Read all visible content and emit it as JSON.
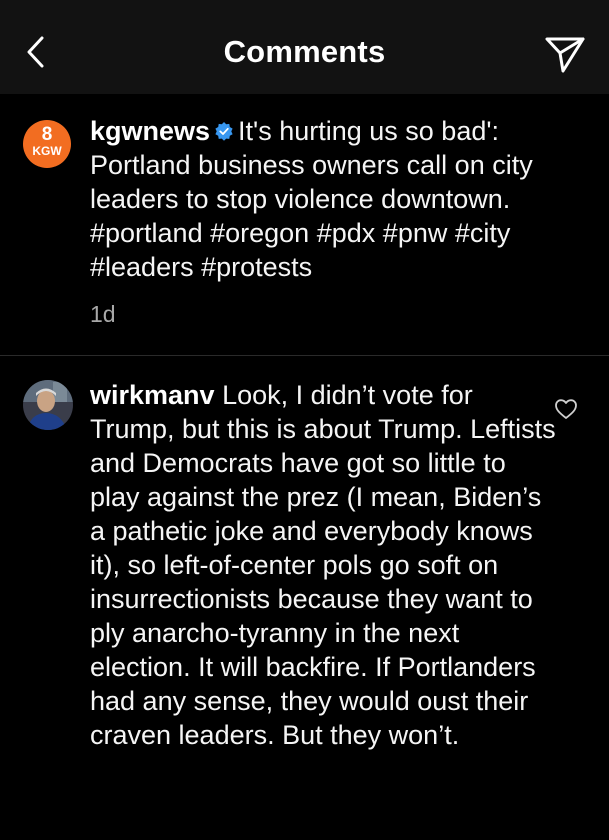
{
  "header": {
    "title": "Comments",
    "back_icon": "chevron-left-icon",
    "send_icon": "paper-plane-icon"
  },
  "caption": {
    "avatar_text_top": "8",
    "avatar_text_bottom": "KGW",
    "avatar_color": "#f26d21",
    "username": "kgwnews",
    "verified_icon": "verified-badge-icon",
    "text": "It's hurting us so bad': Portland business owners call on city leaders to stop violence downtown.",
    "hashtags": [
      "#portland",
      "#oregon",
      "#pdx",
      "#pnw",
      "#city",
      "#leaders",
      "#protests"
    ],
    "time": "1d"
  },
  "comment": {
    "username": "wirkmanv",
    "text": "Look, I didn’t vote for Trump, but this is about Trump. Leftists and Democrats have got so little to play against the prez (I mean, Biden’s a pathetic joke and everybody knows it), so left-of-center pols go soft on insurrectionists because they want to ply anarcho-tyranny in the next election. It will backfire. If Portlanders had any sense, they would oust their craven leaders. But they won’t.",
    "like_icon": "heart-outline-icon"
  }
}
